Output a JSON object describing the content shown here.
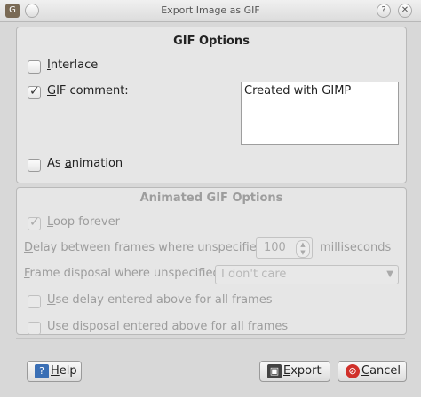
{
  "window": {
    "title": "Export Image as GIF",
    "app_icon": "gimp-icon",
    "minimize": "⌄",
    "close": "✕",
    "help_bubble": "?"
  },
  "gif_options": {
    "title": "GIF Options",
    "interlace": {
      "label": "Interlace",
      "checked": false
    },
    "gif_comment": {
      "label": "GIF comment:",
      "checked": true
    },
    "comment_value": "Created with GIMP",
    "as_animation": {
      "label": "As animation",
      "checked": false
    }
  },
  "animated_options": {
    "title": "Animated GIF Options",
    "loop_forever": {
      "label": "Loop forever",
      "checked": true
    },
    "delay_label": "Delay between frames where unspecified:",
    "delay_value": "100",
    "delay_units": "milliseconds",
    "disposal_label": "Frame disposal where unspecified:",
    "disposal_value": "I don't care",
    "use_delay": {
      "label": "Use delay entered above for all frames",
      "checked": false
    },
    "use_disposal": {
      "label": "Use disposal entered above for all frames",
      "checked": false
    }
  },
  "buttons": {
    "help": "Help",
    "export": "Export",
    "cancel": "Cancel"
  },
  "colors": {
    "background": "#d8d8d8",
    "cancel_icon": "#d0302a",
    "help_icon": "#3a6fb5",
    "export_icon": "#444444"
  }
}
